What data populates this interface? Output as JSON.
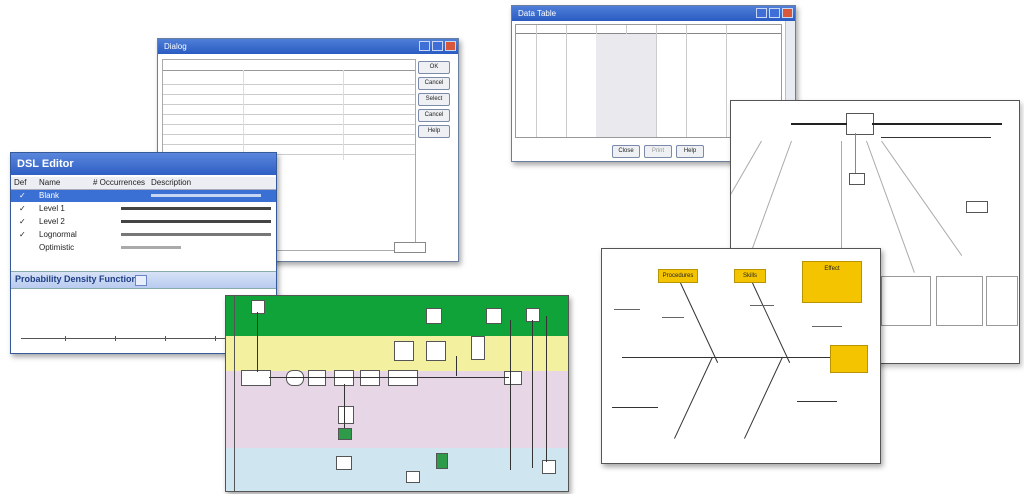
{
  "windows": {
    "top_center": {
      "title": "Dialog",
      "buttons": [
        "OK",
        "Cancel",
        "Select",
        "Cancel",
        "Help"
      ]
    },
    "dsl_editor": {
      "title": "DSL Editor",
      "col_headers": [
        "Def",
        "Name",
        "# Occurrences",
        "Description"
      ],
      "rows": [
        {
          "mark": "✓",
          "name": "Blank",
          "occ": "",
          "desc": ""
        },
        {
          "mark": "✓",
          "name": "Level 1",
          "occ": "",
          "desc": ""
        },
        {
          "mark": "✓",
          "name": "Level 2",
          "occ": "",
          "desc": ""
        },
        {
          "mark": "✓",
          "name": "Lognormal",
          "occ": "",
          "desc": ""
        },
        {
          "mark": "",
          "name": "Optimistic",
          "occ": "",
          "desc": ""
        }
      ],
      "section_title": "Probability Density Function"
    },
    "right_top": {
      "title": "Data Table",
      "buttons": [
        "Close",
        "Print",
        "Help"
      ]
    }
  },
  "fishbone": {
    "labels": [
      "Procedures",
      "Skills",
      "Effect"
    ]
  },
  "colors": {
    "titlebar": "#2a5bc2",
    "selection": "#3a6fd3",
    "swim_green": "#0fa33a",
    "swim_yellow": "#f3f0a0",
    "swim_pink": "#e7d6e6",
    "swim_blue": "#cfe6f0",
    "fishbone_yellow": "#f5c400"
  }
}
